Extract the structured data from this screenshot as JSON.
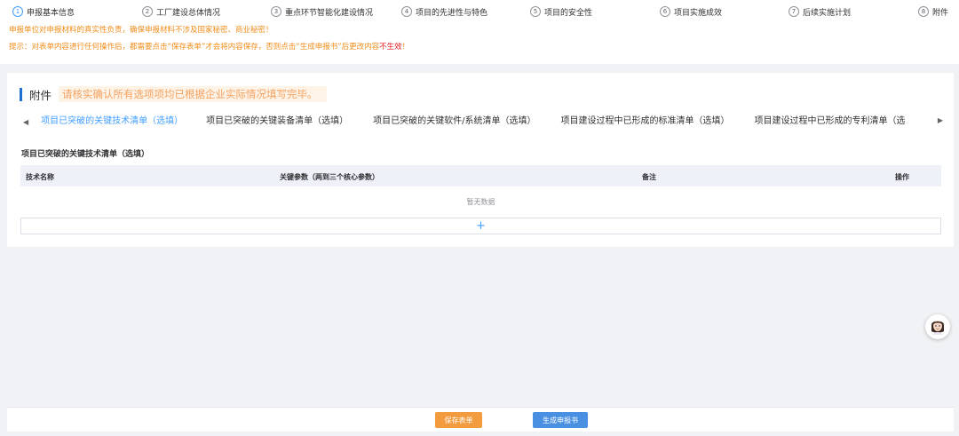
{
  "steps": [
    {
      "num": "1",
      "label": "申报基本信息",
      "active": true
    },
    {
      "num": "2",
      "label": "工厂建设总体情况"
    },
    {
      "num": "3",
      "label": "重点环节智能化建设情况"
    },
    {
      "num": "4",
      "label": "项目的先进性与特色"
    },
    {
      "num": "5",
      "label": "项目的安全性"
    },
    {
      "num": "6",
      "label": "项目实施成效"
    },
    {
      "num": "7",
      "label": "后续实施计划"
    },
    {
      "num": "8",
      "label": "附件"
    }
  ],
  "notice": {
    "line1": "申报单位对申报材料的真实性负责，确保申报材料不涉及国家秘密、商业秘密！",
    "line2_prefix": "提示：对表单内容进行任何操作后，都需要点击“保存表单”才会将内容保存，否则点击“生成申报书”后更改内容",
    "line2_red": "不生效",
    "line2_suffix": "！"
  },
  "section": {
    "title": "附件",
    "hint": "请核实确认所有选项项均已根据企业实际情况填写完毕。"
  },
  "tabs": [
    "项目已突破的关键技术清单（选填）",
    "项目已突破的关键装备清单（选填）",
    "项目已突破的关键软件/系统清单（选填）",
    "项目建设过程中已形成的标准清单（选填）",
    "项目建设过程中已形成的专利清单（选"
  ],
  "table": {
    "title": "项目已突破的关键技术清单（选填）",
    "columns": [
      "技术名称",
      "关键参数（两到三个核心参数）",
      "备注",
      "操作"
    ],
    "empty_text": "暂无数据",
    "add_symbol": "+"
  },
  "footer": {
    "save_label": "保存表单",
    "generate_label": "生成申报书"
  },
  "colors": {
    "accent": "#409eff",
    "warning": "#f08c1a",
    "danger": "#e42020",
    "save_button": "#f39c3f",
    "generate_button": "#4a90e2"
  }
}
